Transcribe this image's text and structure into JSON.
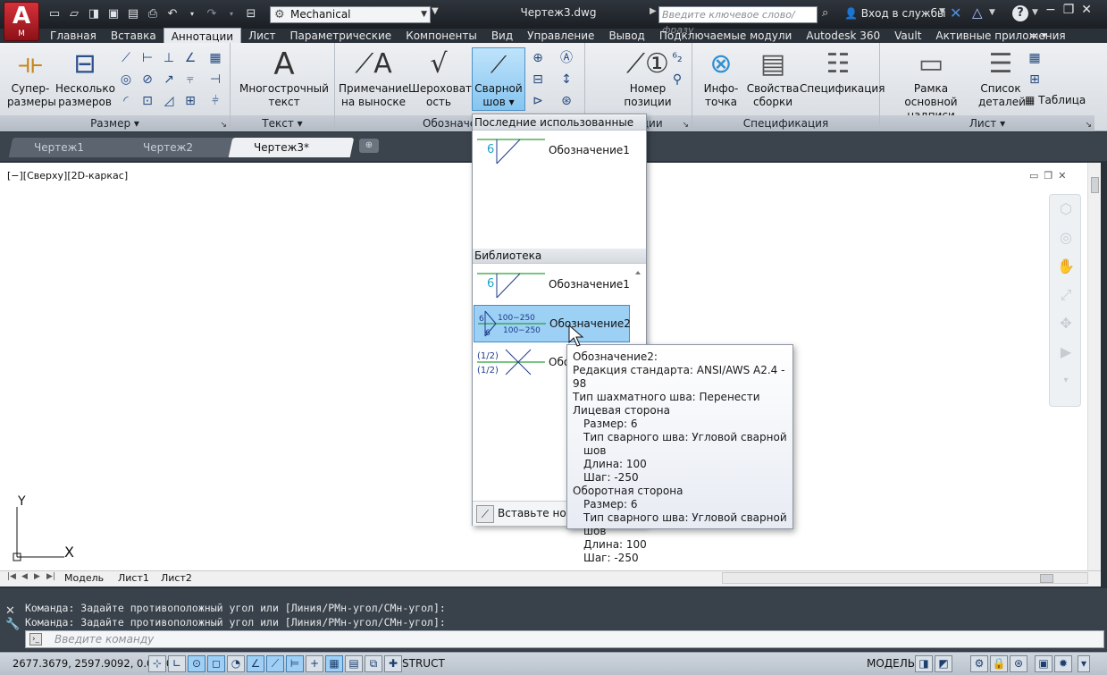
{
  "app": {
    "logo_letter": "A",
    "logo_sub": "M",
    "workspace": "Mechanical",
    "title": "Чертеж3.dwg",
    "search_placeholder": "Введите ключевое слово/фразу",
    "signin": "Вход в службы"
  },
  "ribbon_tabs": [
    "Главная",
    "Вставка",
    "Аннотации",
    "Лист",
    "Параметрические",
    "Компоненты",
    "Вид",
    "Управление",
    "Вывод",
    "Подключаемые модули",
    "Autodesk 360",
    "Vault",
    "Активные приложения"
  ],
  "active_tab_index": 2,
  "panels": {
    "dimension": {
      "title": "Размер",
      "super_dim_l1": "Супер-",
      "super_dim_l2": "размеры",
      "multi_dim_l1": "Несколько",
      "multi_dim_l2": "размеров"
    },
    "text": {
      "title": "Текст",
      "mtext_l1": "Многострочный",
      "mtext_l2": "текст"
    },
    "symbols": {
      "title": "Обозначения",
      "leader_l1": "Примечание",
      "leader_l2": "на выноске",
      "rough_l1": "Шероховат",
      "rough_l2": "ость",
      "weld_l1": "Сварной",
      "weld_l2": "шов"
    },
    "balloons": {
      "title": "Позиции",
      "balloon": "Номер позиции"
    },
    "bom": {
      "title": "Спецификация",
      "info_l1": "Инфо-",
      "info_l2": "точка",
      "assy_l1": "Свойства",
      "assy_l2": "сборки",
      "spec": "Спецификация"
    },
    "sheet": {
      "title": "Лист",
      "frame_l1": "Рамка",
      "frame_l2": "основной надписи",
      "parts_l1": "Список",
      "parts_l2": "деталей",
      "table": "Таблица"
    }
  },
  "doc_tabs": [
    "Чертеж1",
    "Чертеж2",
    "Чертеж3*"
  ],
  "viewport_label": "[−][Сверху][2D-каркас]",
  "layout_tabs": [
    "Модель",
    "Лист1",
    "Лист2"
  ],
  "gallery": {
    "recent_header": "Последние использованные",
    "library_header": "Библиотека",
    "recent_item": "Обозначение1",
    "lib_item1": "Обозначение1",
    "lib_item2": "Обозначение2",
    "lib_item3": "Обо",
    "footer": "Вставьте ново",
    "weld_size": "6",
    "weld_ref1": "100−250",
    "weld_ref2": "100−250",
    "frac": "(1/2)"
  },
  "tooltip": {
    "title": "Обозначение2:",
    "standard": "Редакция стандарта: ANSI/AWS A2.4 - 98",
    "stagger": "Тип шахматного шва: Перенести",
    "front": "Лицевая сторона",
    "front_size": "Размер: 6",
    "front_type": "Тип сварного шва: Угловой сварной шов",
    "front_len": "Длина: 100",
    "front_pitch": "Шаг: -250",
    "back": "Оборотная сторона",
    "back_size": "Размер: 6",
    "back_type": "Тип сварного шва: Угловой сварной шов",
    "back_len": "Длина: 100",
    "back_pitch": "Шаг: -250"
  },
  "command": {
    "line1": "Команда: Задайте противоположный угол или [Линия/РМн-угол/СМн-угол]:",
    "line2": "Команда: Задайте противоположный угол или [Линия/РМн-угол/СМн-угол]:",
    "placeholder": "Введите команду"
  },
  "status": {
    "coords": "2677.3679, 2597.9092, 0.0000",
    "struct": "STRUCT",
    "model": "МОДЕЛЬ"
  },
  "ucs": {
    "x": "X",
    "y": "Y"
  }
}
